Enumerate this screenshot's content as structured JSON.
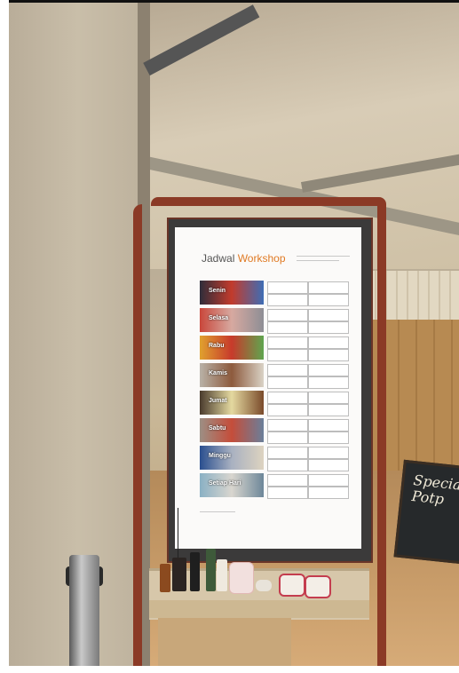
{
  "screen": {
    "title_prefix": "Jadwal ",
    "title_accent": "Workshop",
    "accent_color": "#e07a24",
    "days": [
      "Senin",
      "Selasa",
      "Rabu",
      "Kamis",
      "Jumat",
      "Sabtu",
      "Minggu",
      "Setiap Hari"
    ]
  },
  "chalkboard": {
    "line1": "Special",
    "line2": "Potp"
  }
}
